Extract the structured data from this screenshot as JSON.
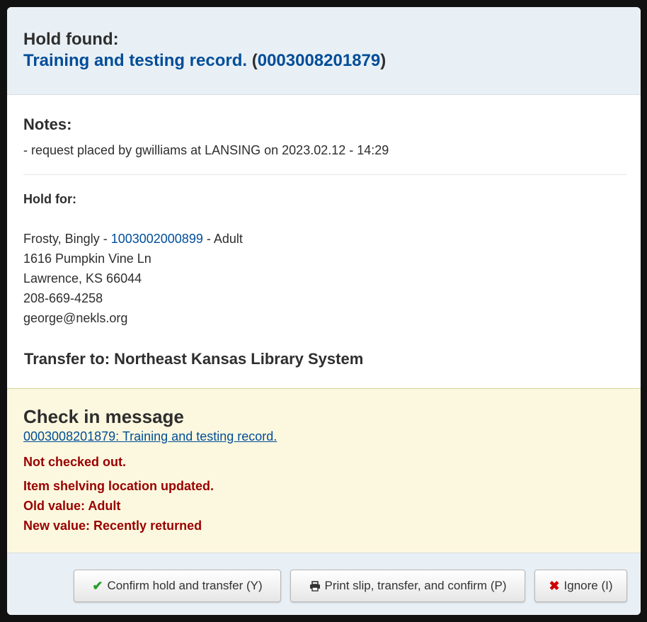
{
  "header": {
    "label": "Hold found:",
    "title": "Training and testing record.",
    "paren_open": "(",
    "barcode": "0003008201879",
    "paren_close": ")"
  },
  "notes": {
    "title": "Notes:",
    "text": "- request placed by gwilliams at LANSING on 2023.02.12 - 14:29"
  },
  "hold_for": {
    "title": "Hold for:",
    "name": "Frosty, Bingly - ",
    "card_number": "1003002000899",
    "category": " - Adult",
    "address1": "1616 Pumpkin Vine Ln",
    "address2": "Lawrence, KS 66044",
    "phone": "208-669-4258",
    "email": "george@nekls.org"
  },
  "transfer": {
    "text": "Transfer to: Northeast Kansas Library System"
  },
  "checkin": {
    "title": "Check in message",
    "item_link": "0003008201879: Training and testing record.",
    "not_checked_out": "Not checked out.",
    "location_updated": "Item shelving location updated.",
    "old_value": "Old value: Adult",
    "new_value": "New value: Recently returned"
  },
  "buttons": {
    "confirm": "Confirm hold and transfer (Y)",
    "print": "Print slip, transfer, and confirm (P)",
    "ignore": "Ignore (I)"
  },
  "icons": {
    "confirm": "check-icon",
    "print": "print-icon",
    "ignore": "close-icon"
  },
  "colors": {
    "link": "#004d99",
    "alert": "#990000",
    "header_bg": "#e9f0f5",
    "checkin_bg": "#fcf8df"
  }
}
